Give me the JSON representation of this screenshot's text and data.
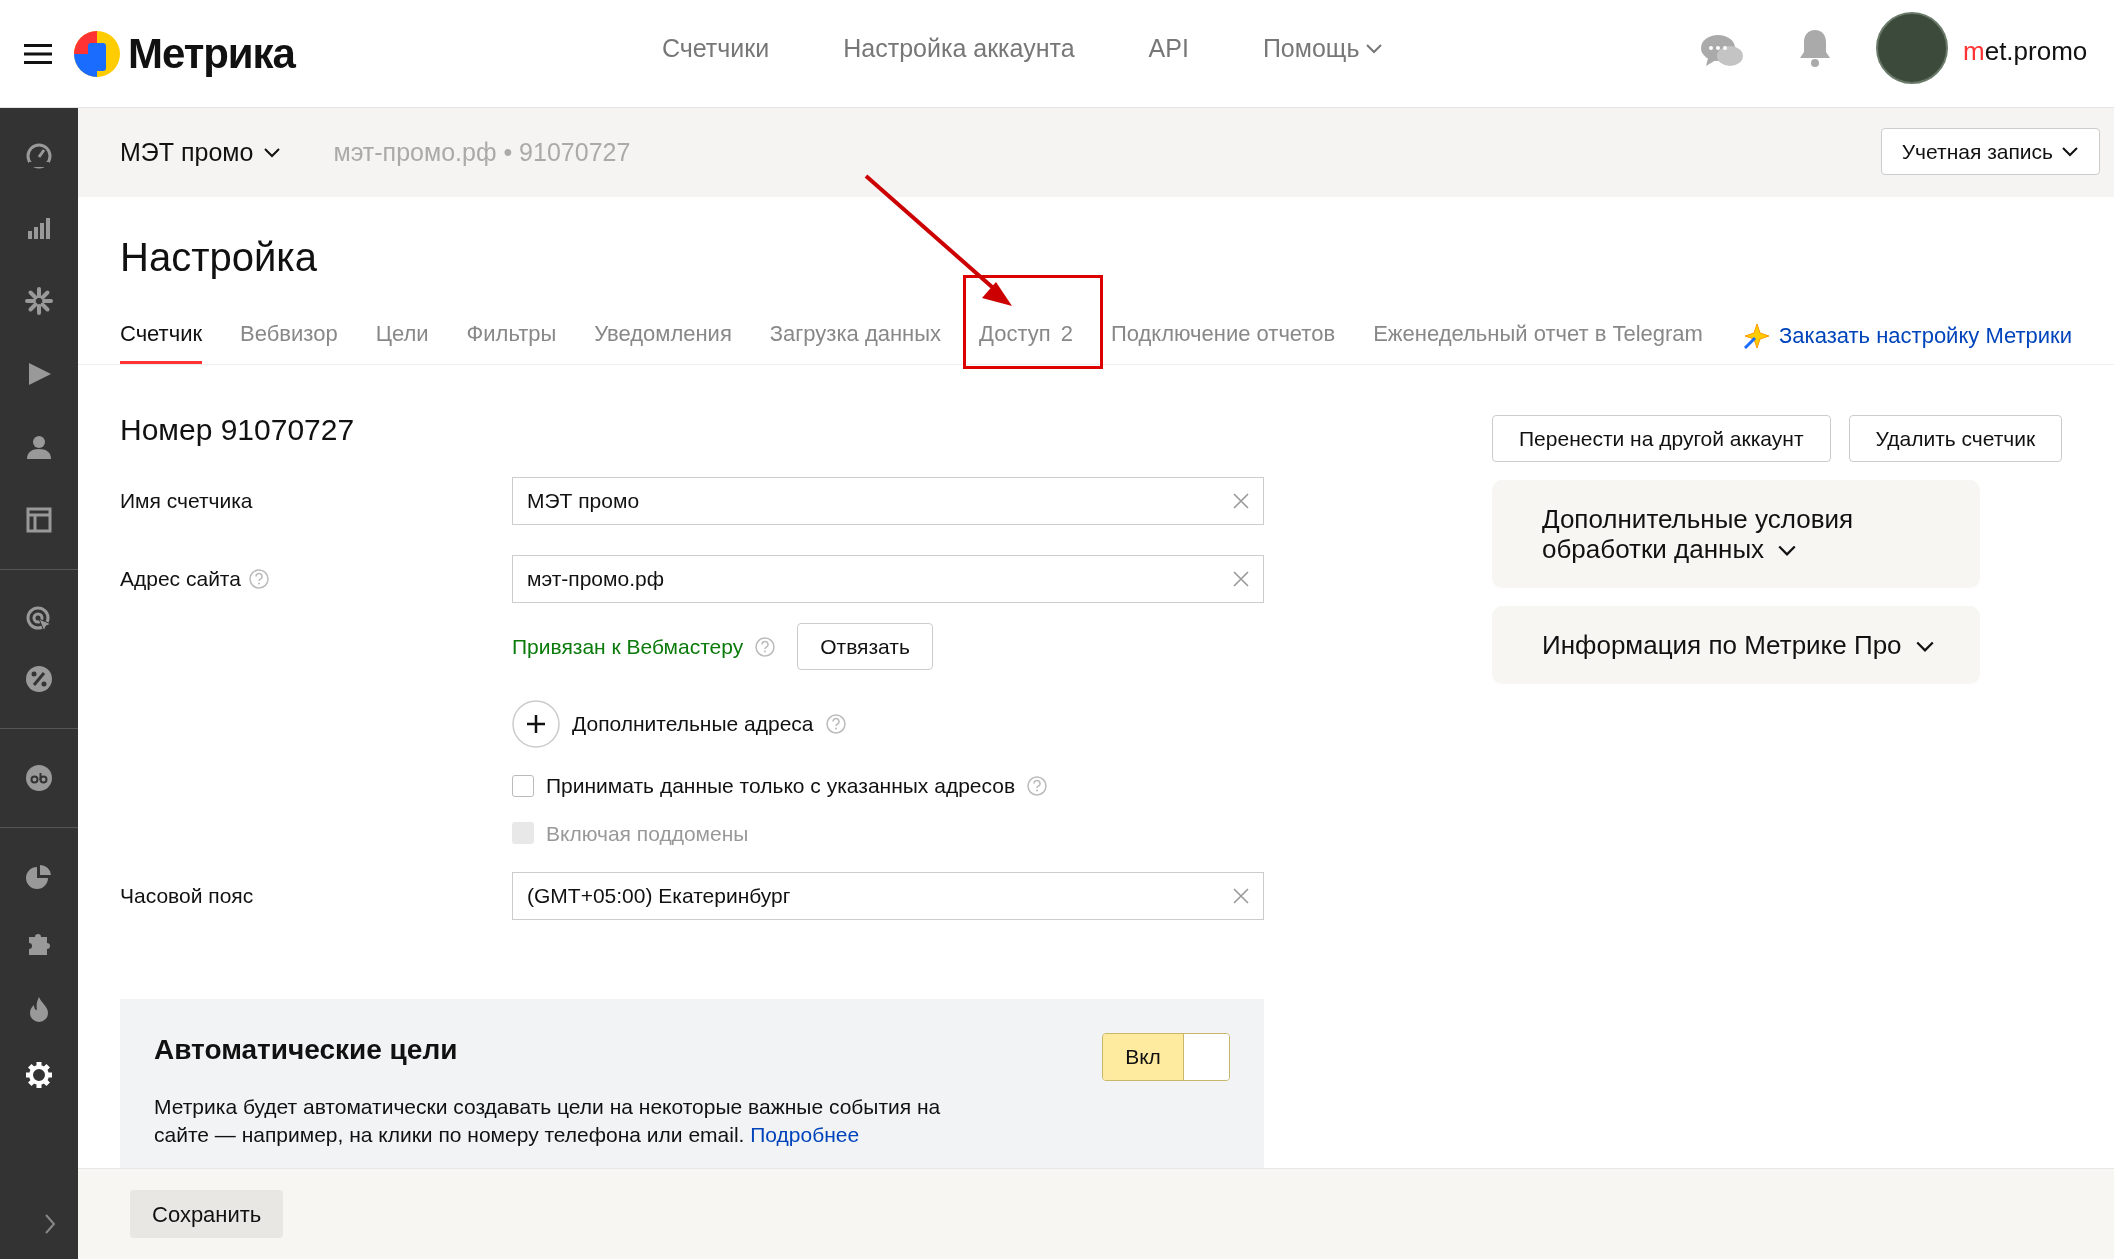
{
  "header": {
    "logo_text": "Метрика",
    "nav": [
      {
        "label": "Счетчики",
        "dropdown": false
      },
      {
        "label": "Настройка аккаунта",
        "dropdown": false
      },
      {
        "label": "API",
        "dropdown": false
      },
      {
        "label": "Помощь",
        "dropdown": true
      }
    ],
    "login_first_letter": "m",
    "login_rest": "et.promo"
  },
  "sidebar": {
    "groups": [
      [
        {
          "selected": false
        },
        {
          "selected": false
        },
        {
          "selected": false
        },
        {
          "selected": false
        },
        {
          "selected": false
        },
        {
          "selected": false
        }
      ],
      [
        {
          "selected": false
        },
        {
          "selected": false
        }
      ],
      [
        {
          "selected": false
        }
      ],
      [
        {
          "selected": false
        },
        {
          "selected": false
        },
        {
          "selected": false
        },
        {
          "selected": true
        }
      ]
    ]
  },
  "counter_bar": {
    "name": "МЭТ промо",
    "site": "мэт-промо.рф",
    "separator": "•",
    "id": "91070727",
    "account_button": "Учетная запись"
  },
  "page_title": "Настройка",
  "tabs": [
    {
      "label": "Счетчик",
      "selected": true,
      "annotated": false
    },
    {
      "label": "Вебвизор",
      "selected": false,
      "annotated": false
    },
    {
      "label": "Цели",
      "selected": false,
      "annotated": false
    },
    {
      "label": "Фильтры",
      "selected": false,
      "annotated": false
    },
    {
      "label": "Уведомления",
      "selected": false,
      "annotated": false
    },
    {
      "label": "Загрузка данных",
      "selected": false,
      "annotated": false
    },
    {
      "label": "Доступ",
      "count": "2",
      "selected": false,
      "annotated": true
    },
    {
      "label": "Подключение отчетов",
      "selected": false,
      "annotated": false
    },
    {
      "label": "Еженедельный отчет в Telegram",
      "selected": false,
      "annotated": false
    }
  ],
  "promo_link": "Заказать настройку Метрики",
  "form": {
    "heading": "Номер 91070727",
    "name_label": "Имя счетчика",
    "name_value": "МЭТ промо",
    "site_label": "Адрес сайта",
    "site_value": "мэт-промо.рф",
    "webmaster_status": "Привязан к Вебмастеру",
    "unlink_button": "Отвязать",
    "extra_addresses": "Дополнительные адреса",
    "checkboxes": [
      {
        "label": "Принимать данные только с указанных адресов",
        "checked": false,
        "disabled": false,
        "help": true
      },
      {
        "label": "Включая поддомены",
        "checked": false,
        "disabled": true,
        "help": false
      }
    ],
    "timezone_label": "Часовой пояс",
    "timezone_value": "(GMT+05:00) Екатеринбург"
  },
  "side_buttons": [
    "Перенести на другой аккаунт",
    "Удалить счетчик"
  ],
  "side_cards": [
    {
      "title": "Дополнительные условия обработки данных",
      "expanded": false
    },
    {
      "title": "Информация по Метрике Про",
      "expanded": false
    }
  ],
  "auto_goals": {
    "title": "Автоматические цели",
    "text": "Метрика будет автоматически создавать цели на некоторые важные события на сайте — например, на клики по номеру телефона или email.",
    "link": "Подробнее",
    "toggle_label": "Вкл",
    "on": true
  },
  "save_button": "Сохранить"
}
